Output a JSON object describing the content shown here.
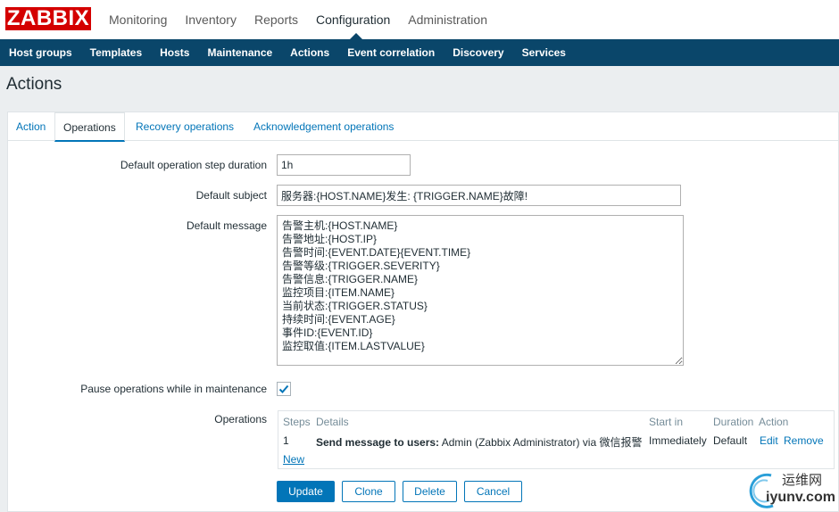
{
  "logo": "ZABBIX",
  "topnav": [
    "Monitoring",
    "Inventory",
    "Reports",
    "Configuration",
    "Administration"
  ],
  "subnav": [
    "Host groups",
    "Templates",
    "Hosts",
    "Maintenance",
    "Actions",
    "Event correlation",
    "Discovery",
    "Services"
  ],
  "page_title": "Actions",
  "tabs": [
    "Action",
    "Operations",
    "Recovery operations",
    "Acknowledgement operations"
  ],
  "form": {
    "step_duration_label": "Default operation step duration",
    "step_duration_value": "1h",
    "subject_label": "Default subject",
    "subject_value": "服务器:{HOST.NAME}发生: {TRIGGER.NAME}故障!",
    "message_label": "Default message",
    "message_value": "告警主机:{HOST.NAME}\n告警地址:{HOST.IP}\n告警时间:{EVENT.DATE}{EVENT.TIME}\n告警等级:{TRIGGER.SEVERITY}\n告警信息:{TRIGGER.NAME}\n监控项目:{ITEM.NAME}\n当前状态:{TRIGGER.STATUS}\n持续时间:{EVENT.AGE}\n事件ID:{EVENT.ID}\n监控取值:{ITEM.LASTVALUE}",
    "pause_label": "Pause operations while in maintenance",
    "pause_checked": true,
    "operations_label": "Operations"
  },
  "operations_table": {
    "headers": [
      "Steps",
      "Details",
      "Start in",
      "Duration",
      "Action"
    ],
    "row": {
      "steps": "1",
      "details_bold": "Send message to users:",
      "details_rest": " Admin (Zabbix Administrator) via 微信报警",
      "start_in": "Immediately",
      "duration": "Default",
      "edit": "Edit",
      "remove": "Remove"
    },
    "new_link": "New"
  },
  "buttons": {
    "update": "Update",
    "clone": "Clone",
    "delete": "Delete",
    "cancel": "Cancel"
  },
  "watermark": {
    "cn": "运维网",
    "url": "iyunv.com"
  },
  "colors": {
    "brand_red": "#d40000",
    "subnav_bg": "#0a466a",
    "accent": "#0275b8"
  }
}
